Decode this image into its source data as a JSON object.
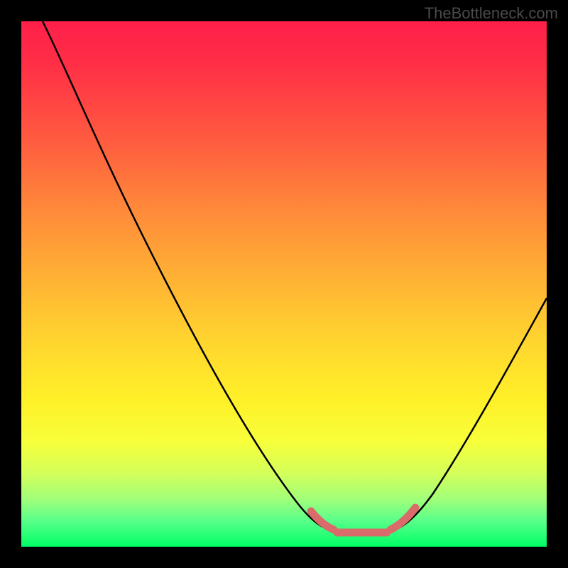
{
  "watermark": "TheBottleneck.com",
  "chart_data": {
    "type": "line",
    "title": "",
    "xlabel": "",
    "ylabel": "",
    "xlim": [
      0,
      100
    ],
    "ylim": [
      0,
      100
    ],
    "grid": false,
    "series": [
      {
        "name": "bottleneck-curve",
        "color": "#000000",
        "x": [
          4,
          10,
          20,
          30,
          40,
          50,
          55,
          58,
          60,
          65,
          70,
          72,
          78,
          85,
          92,
          100
        ],
        "y": [
          100,
          88,
          70,
          52,
          35,
          18,
          10,
          6,
          4,
          3,
          3,
          4,
          10,
          22,
          38,
          56
        ]
      },
      {
        "name": "optimal-zone-marker",
        "color": "#d96b6b",
        "x_start": 56,
        "x_end": 73,
        "y_base": 3
      }
    ],
    "annotations": [],
    "background_gradient": {
      "top": "#ff1f4a",
      "middle": "#ffd82e",
      "bottom": "#00ff66"
    }
  }
}
